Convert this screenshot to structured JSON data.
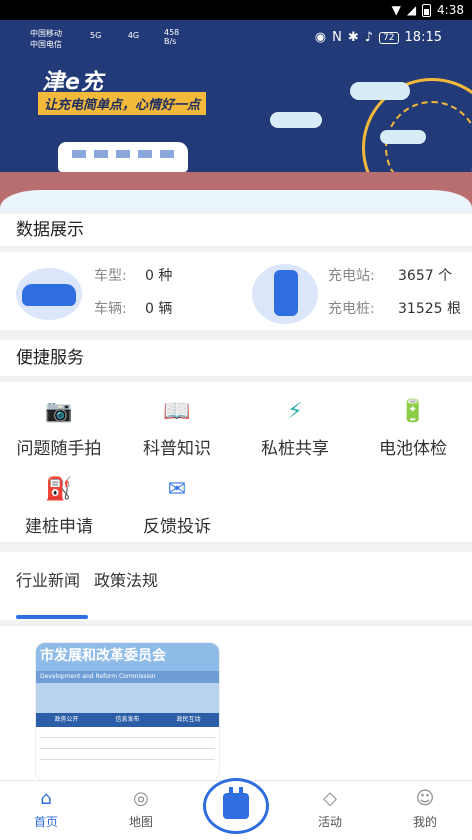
{
  "system_status": {
    "time": "4:38"
  },
  "banner": {
    "inner_status": {
      "carrier1": "中国移动",
      "carrier2": "中国电信",
      "net1": "5G",
      "net2": "4G",
      "speed": "458",
      "speed_unit": "B/s",
      "battery": "72",
      "time": "18:15"
    },
    "logo": "津e充",
    "slogan": "让充电简单点，心情好一点"
  },
  "data_display": {
    "title": "数据展示",
    "stats": [
      {
        "label": "车型:",
        "value": "0 种"
      },
      {
        "label": "车辆:",
        "value": "0 辆"
      },
      {
        "label": "充电站:",
        "value": "3657 个"
      },
      {
        "label": "充电桩:",
        "value": "31525 根"
      }
    ]
  },
  "quick_services": {
    "title": "便捷服务",
    "items": [
      {
        "label": "问题随手拍",
        "icon": "camera-icon"
      },
      {
        "label": "科普知识",
        "icon": "book-icon"
      },
      {
        "label": "私桩共享",
        "icon": "plug-share-icon"
      },
      {
        "label": "电池体检",
        "icon": "battery-icon"
      },
      {
        "label": "建桩申请",
        "icon": "charger-apply-icon"
      },
      {
        "label": "反馈投诉",
        "icon": "feedback-mail-icon"
      }
    ]
  },
  "news_tabs": [
    {
      "label": "行业新闻",
      "active": true
    },
    {
      "label": "政策法规",
      "active": false
    }
  ],
  "news_image": {
    "header": "市发展和改革委员会",
    "subheader": "Development and Reform Commission",
    "nav": [
      "政务公开",
      "信息发布",
      "政民互动"
    ]
  },
  "bottom_nav": [
    {
      "label": "首页",
      "icon": "home-icon",
      "active": true
    },
    {
      "label": "地图",
      "icon": "map-pin-icon",
      "active": false
    },
    {
      "label": "活动",
      "icon": "cube-icon",
      "active": false
    },
    {
      "label": "我的",
      "icon": "smile-icon",
      "active": false
    }
  ],
  "colors": {
    "accent": "#2f6ee0",
    "banner_bg": "#223a78",
    "slogan_bg": "#f3b93a"
  }
}
